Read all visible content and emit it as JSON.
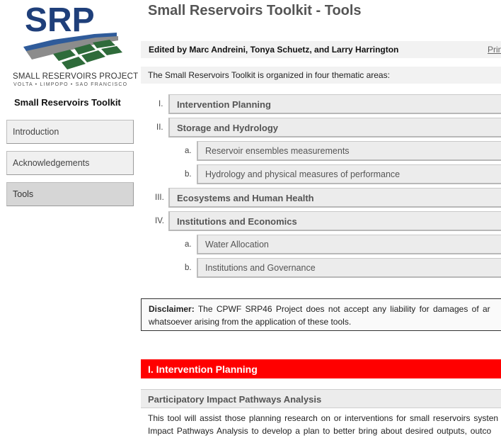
{
  "logo": {
    "word": "SRP",
    "title": "SMALL RESERVOIRS PROJECT",
    "subtitle": "VOLTA • LIMPOPO • SAO FRANCISCO",
    "colors": {
      "text": "#1f3f7a",
      "water": "#2f5b9a",
      "land": "#2e6b3a",
      "road": "#8c8c8c"
    }
  },
  "sidebar": {
    "title": "Small Reservoirs Toolkit",
    "items": [
      {
        "label": "Introduction",
        "active": false
      },
      {
        "label": "Acknowledgements",
        "active": false
      },
      {
        "label": "Tools",
        "active": true
      }
    ]
  },
  "main": {
    "title": "Small Reservoirs Toolkit - Tools",
    "editors": "Edited by Marc Andreini, Tonya Schuetz, and Larry Harrington",
    "print_link": "Prin",
    "intro": "The Small Reservoirs Toolkit is organized in four thematic areas:",
    "areas": [
      {
        "num": "I.",
        "label": "Intervention Planning",
        "subs": []
      },
      {
        "num": "II.",
        "label": "Storage and Hydrology",
        "subs": [
          {
            "num": "a.",
            "label": "Reservoir ensembles measurements"
          },
          {
            "num": "b.",
            "label": "Hydrology and physical measures of performance"
          }
        ]
      },
      {
        "num": "III.",
        "label": "Ecosystems and Human Health",
        "subs": []
      },
      {
        "num": "IV.",
        "label": "Institutions and Economics",
        "subs": [
          {
            "num": "a.",
            "label": "Water Allocation"
          },
          {
            "num": "b.",
            "label": "Institutions and Governance"
          }
        ]
      }
    ],
    "disclaimer": {
      "label": "Disclaimer:",
      "line1": "The CPWF SRP46 Project does not accept any liability for damages of ar",
      "line2": "whatsoever arising from the application of these tools."
    },
    "section": {
      "header": "I. Intervention Planning",
      "header_color": "#ff0000",
      "tool_title": "Participatory Impact Pathways Analysis",
      "desc_line1": "This tool will assist those planning research on or interventions for small reservoirs systen",
      "desc_line2": "Impact Pathways Analysis to develop a plan to better bring about desired outputs, outco"
    }
  }
}
